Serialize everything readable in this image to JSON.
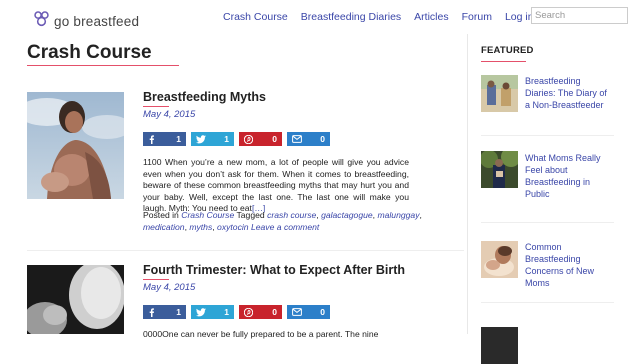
{
  "header": {
    "logo_text": "go breastfeed",
    "nav": [
      {
        "label": "Crash Course"
      },
      {
        "label": "Breastfeeding Diaries"
      },
      {
        "label": "Articles"
      },
      {
        "label": "Forum"
      },
      {
        "label": "Log in / Sign Up"
      }
    ],
    "search_placeholder": "Search"
  },
  "page": {
    "title": "Crash Course"
  },
  "posts": [
    {
      "title": "Breastfeeding Myths",
      "date": "May 4, 2015",
      "shares": {
        "facebook": "1",
        "twitter": "1",
        "pinterest": "0",
        "email": "0"
      },
      "excerpt": "1100 When you’re a new mom, a lot of people will give you advice even when you don’t ask for them. When it comes to breastfeeding, beware of these common breastfeeding myths that may hurt you and your baby. Well, except the last one. The last one will make you laugh.   Myth: You need to eat",
      "read_more": "[…]",
      "meta_posted_in": "Posted in",
      "category": "Crash Course",
      "meta_tagged": "Tagged",
      "tags": [
        "crash course",
        "galactagogue",
        "malunggay",
        "medication",
        "myths",
        "oxytocin"
      ],
      "leave_comment": "Leave a comment"
    },
    {
      "title": "Fourth Trimester: What to Expect After Birth",
      "date": "May 4, 2015",
      "shares": {
        "facebook": "1",
        "twitter": "1",
        "pinterest": "0",
        "email": "0"
      },
      "excerpt_partial": "0000One can never be fully prepared to be a parent.   The nine"
    }
  ],
  "sidebar": {
    "heading": "FEATURED",
    "items": [
      {
        "label": "Breastfeeding Diaries: The Diary of a Non-Breastfeeder"
      },
      {
        "label": "What Moms Really Feel about Breastfeeding in Public"
      },
      {
        "label": "Common Breastfeeding Concerns of New Moms"
      }
    ]
  },
  "colors": {
    "accent": "#e4506a",
    "link": "#3a46a8",
    "facebook": "#3b5d9b",
    "twitter": "#2ea5d6",
    "pinterest": "#c8232c",
    "email": "#2c7fc9",
    "logo_purple": "#6b5bb5"
  },
  "icons": [
    "logo-icon",
    "facebook-icon",
    "twitter-icon",
    "pinterest-icon",
    "email-icon"
  ]
}
